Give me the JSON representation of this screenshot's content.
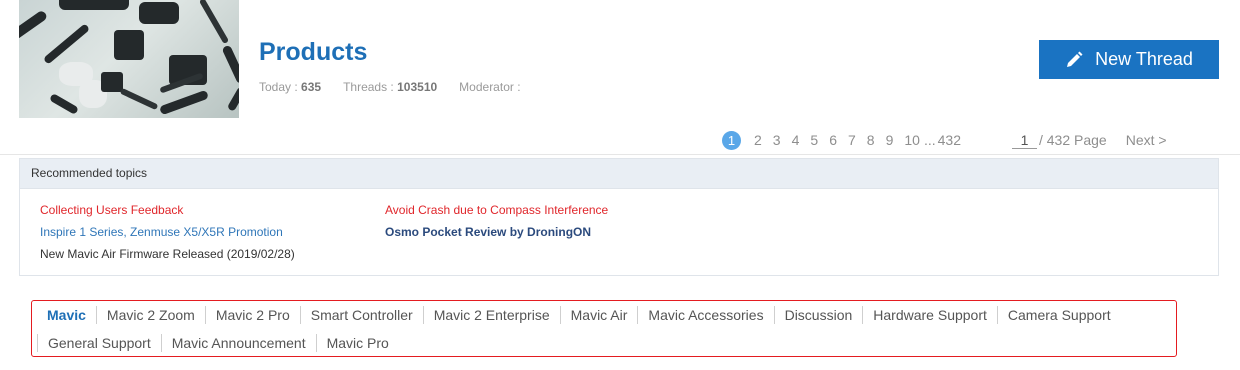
{
  "header": {
    "forum_title": "Products",
    "stats": {
      "today_label": "Today :",
      "today_value": "635",
      "threads_label": "Threads :",
      "threads_value": "103510",
      "moderator_label": "Moderator :"
    },
    "new_thread_label": "New Thread",
    "new_thread_icon": "pencil-icon",
    "colors": {
      "brand_blue": "#1a73c2",
      "title_blue": "#1e6fb6"
    }
  },
  "pagination": {
    "current": "1",
    "pages": [
      "2",
      "3",
      "4",
      "5",
      "6",
      "7",
      "8",
      "9",
      "10"
    ],
    "ellipsis": "...",
    "last": "432",
    "input_value": "1",
    "total_label": "/ 432 Page",
    "next_label": "Next >"
  },
  "recommended": {
    "heading": "Recommended topics",
    "items": [
      {
        "text": "Collecting Users Feedback",
        "color": "#e0262b"
      },
      {
        "text": "Inspire 1 Series, Zenmuse X5/X5R Promotion",
        "color": "#2f76b8"
      },
      {
        "text": "New Mavic Air Firmware Released (2019/02/28)",
        "color": "#333333"
      },
      {
        "text": "Avoid Crash due to Compass Interference",
        "color": "#e0262b"
      },
      {
        "text": "Osmo Pocket Review by DroningON",
        "color": "#2b4a7d"
      }
    ]
  },
  "categories": {
    "row1": [
      "Mavic",
      "Mavic 2 Zoom",
      "Mavic 2 Pro",
      "Smart Controller",
      "Mavic 2 Enterprise",
      "Mavic Air",
      "Mavic Accessories",
      "Discussion",
      "Hardware Support",
      "Camera Support"
    ],
    "row2": [
      "General Support",
      "Mavic Announcement",
      "Mavic Pro"
    ],
    "active": "Mavic",
    "highlight_color": "#e41b20"
  }
}
